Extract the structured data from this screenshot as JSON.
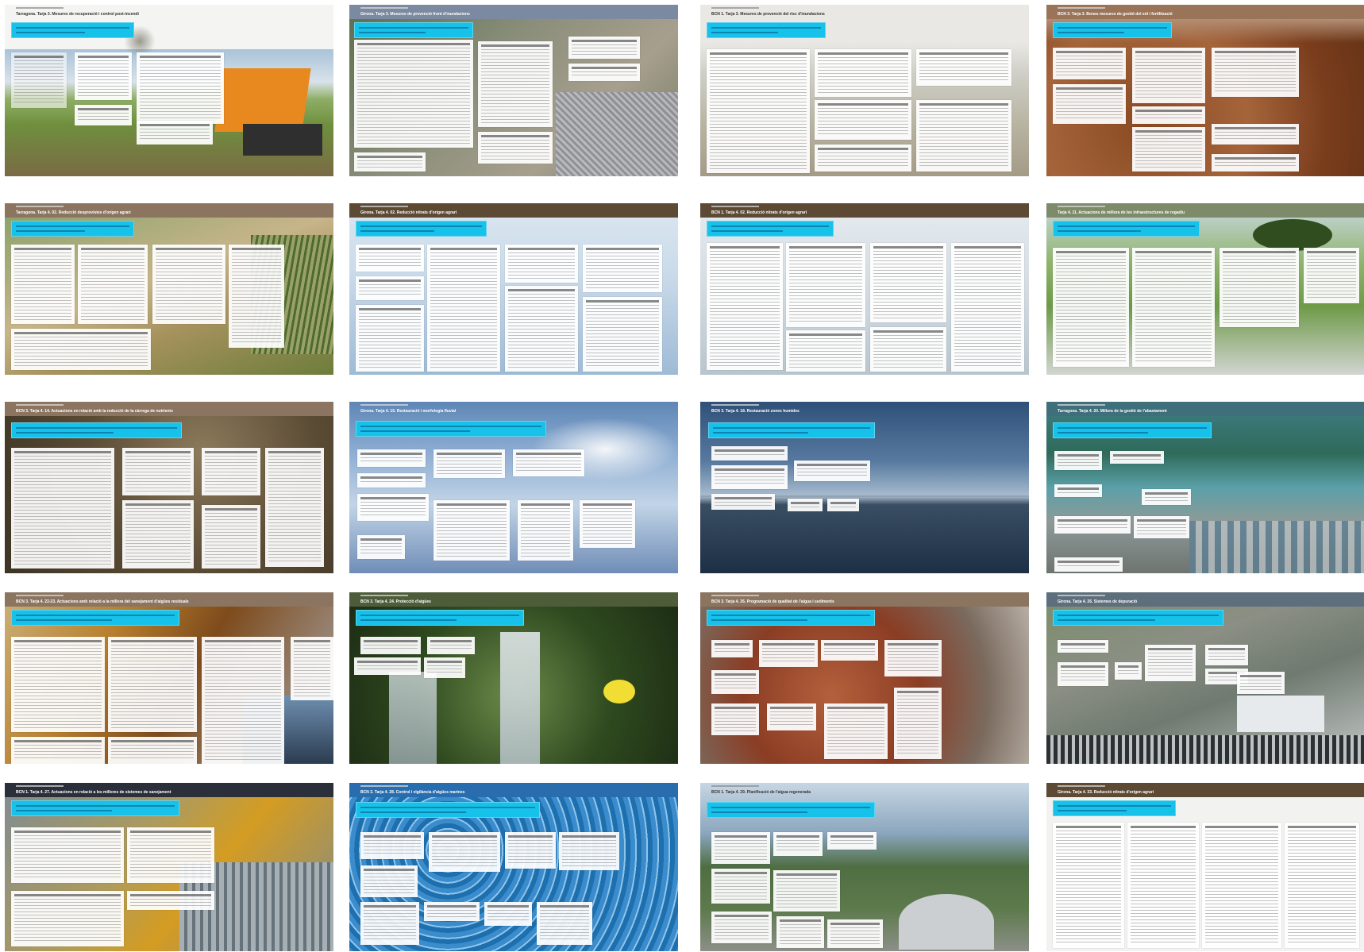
{
  "pages": [
    {
      "title": "Tarragona. Tarja 3. Mesures de recuperació i control post-incendi",
      "theme": "excavator-field"
    },
    {
      "title": "Girona. Tarja 3. Mesures de prevenció front d'inundacions",
      "theme": "gabion-river"
    },
    {
      "title": "BCN 1. Tarja 3. Mesures de prevenció del risc d'inundacions",
      "theme": "pale-grass"
    },
    {
      "title": "BCN 3. Tarja 3. Bones mesures de gestió del sòl i fertilització",
      "theme": "brown-soil"
    },
    {
      "title": "Tarragona. Tarja 4. 02. Reducció desprovistes d'origen agrari",
      "theme": "vineyard-hills"
    },
    {
      "title": "Girona. Tarja 4. 02. Reducció nitrats d'origen agrari",
      "theme": "cloud-sky"
    },
    {
      "title": "BCN 1. Tarja 4. 02. Reducció nitrats d'origen agrari",
      "theme": "pale-sky"
    },
    {
      "title": "Tarja 4. 11. Actuacions de millora de les infraestructures de regadiu",
      "theme": "green-irrigation"
    },
    {
      "title": "BCN 3. Tarja 4. 14. Actuacions en relació amb la reducció de la càrrega de nutrients",
      "theme": "forest-creek"
    },
    {
      "title": "Girona. Tarja 4. 15. Restauració i morfologia fluvial",
      "theme": "blue-clouds"
    },
    {
      "title": "BCN 3. Tarja 4. 18. Restauració zones humides",
      "theme": "lake-evening"
    },
    {
      "title": "Tarragona. Tarja 4. 20. Millora de la gestió de l'abastament",
      "theme": "delta-aerial"
    },
    {
      "title": "BCN 3. Tarja 4. 22-23. Actuacions amb relació a la millora del sanejament d'aigües residuals",
      "theme": "autumn-river"
    },
    {
      "title": "BCN 3. Tarja 4. 24. Protecció d'aigües",
      "theme": "waterfall"
    },
    {
      "title": "BCN 3. Tarja 4. 26. Programació de qualitat de l'aigua i sediments",
      "theme": "red-rocks"
    },
    {
      "title": "Girona. Tarja 4. 26. Sistemes de depuració",
      "theme": "wwtp-aerial"
    },
    {
      "title": "BCN 1. Tarja 4. 27. Actuacions en relació a les millores de sistemes de sanejament",
      "theme": "treatment-tank"
    },
    {
      "title": "BCN 3. Tarja 4. 28. Control i vigilància d'aigües marines",
      "theme": "sea-waves"
    },
    {
      "title": "BCN 1. Tarja 4. 29. Planificació de l'aigua regenerada",
      "theme": "reservoir-dam"
    },
    {
      "title": "Girona. Tarja 4. 33. Reducció nitrats d'origen agrari",
      "theme": "text-dense"
    }
  ]
}
